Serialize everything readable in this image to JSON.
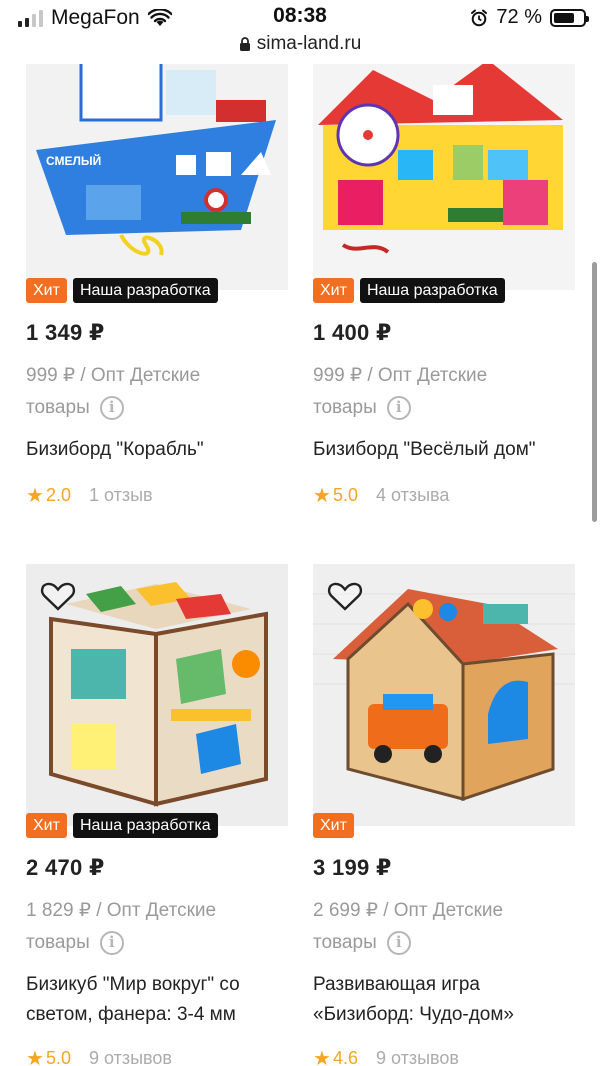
{
  "statusbar": {
    "carrier": "MegaFon",
    "time": "08:38",
    "url": "sima-land.ru",
    "battery_pct": "72 %"
  },
  "icons": {
    "favorite": "heart-outline-icon",
    "info": "info-circle-icon",
    "star": "star-icon"
  },
  "colors": {
    "hit_badge": "#f26f21",
    "dev_badge": "#111111",
    "rating_star": "#f5a623"
  },
  "products": [
    {
      "price": "1 349 ₽",
      "wholesale": "999 ₽ / Опт Детские товары",
      "name": "Бизиборд \"Корабль\"",
      "rating": "2.0",
      "reviews": "1 отзыв",
      "badges": [
        "Хит",
        "Наша разработка"
      ]
    },
    {
      "price": "1 400 ₽",
      "wholesale": "999 ₽ / Опт Детские товары",
      "name": "Бизиборд \"Весёлый дом\"",
      "rating": "5.0",
      "reviews": "4 отзыва",
      "badges": [
        "Хит",
        "Наша разработка"
      ]
    },
    {
      "price": "2 470 ₽",
      "wholesale": "1 829 ₽ / Опт Детские товары",
      "name": "Бизикуб \"Мир вокруг\" со светом, фанера: 3-4 мм",
      "rating": "5.0",
      "reviews": "9 отзывов",
      "badges": [
        "Хит",
        "Наша разработка"
      ]
    },
    {
      "price": "3 199 ₽",
      "wholesale": "2 699 ₽ / Опт Детские товары",
      "name": "Развивающая игра «Бизиборд: Чудо-дом»",
      "rating": "4.6",
      "reviews": "9 отзывов",
      "badges": [
        "Хит"
      ]
    }
  ]
}
